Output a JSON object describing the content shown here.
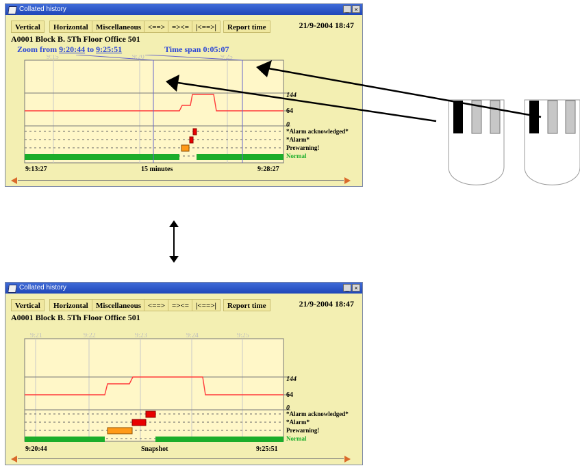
{
  "window": {
    "title": "Collated history",
    "min": "_",
    "close": "×"
  },
  "toolbar": [
    "Vertical",
    "Horizontal",
    "Miscellaneous",
    "<==>",
    "=><=",
    "|<==>|",
    "Report time"
  ],
  "datetime": "21/9-2004 18:47",
  "location": "A0001 Block B. 5Th Floor Office 501",
  "top": {
    "zoom_prefix": "Zoom from ",
    "zoom_from": "9:20:44",
    "zoom_mid": " to ",
    "zoom_to": "9:25:51",
    "timespan": "Time span 0:05:07",
    "ticks": [
      "9:15",
      "9:20",
      "9:25"
    ],
    "left_time": "9:13:27",
    "center_label": "15 minutes",
    "right_time": "9:28:27"
  },
  "bottom": {
    "ticks": [
      "9:21",
      "9:22",
      "9:23",
      "9:24",
      "9:25"
    ],
    "left_time": "9:20:44",
    "center_label": "Snapshot",
    "right_time": "9:25:51"
  },
  "y_labels": [
    "144",
    "64",
    "0"
  ],
  "states": [
    "*Alarm acknowledged*",
    "*Alarm*",
    "Prewarning!",
    "Normal"
  ],
  "colors": {
    "title_blue": "#2c47d6",
    "window_bg": "#f3efb2",
    "plot_bg": "#fff7c8",
    "line_red": "#ff3a3a",
    "alarm_red": "#e80000",
    "prewarn_orange": "#ff9a18",
    "normal_green": "#1bad2a",
    "arrow_orange": "#d96a2b"
  }
}
